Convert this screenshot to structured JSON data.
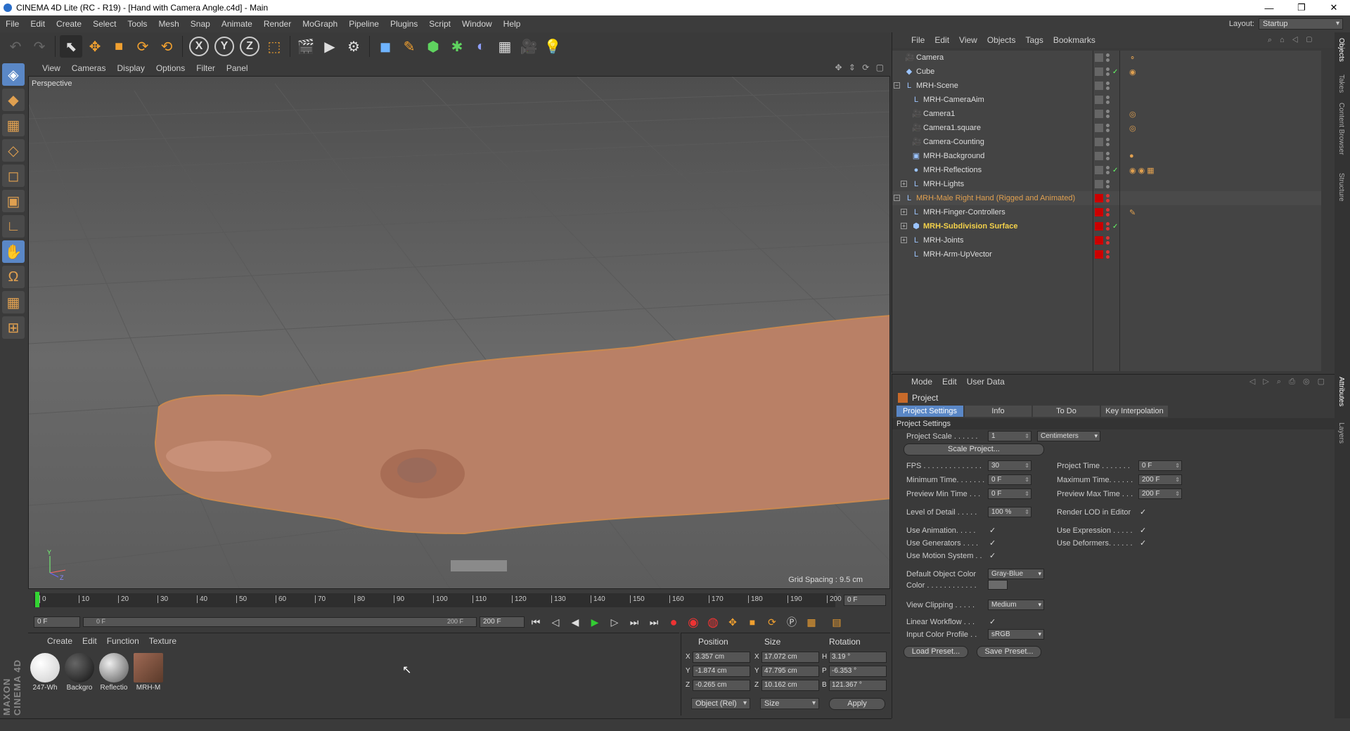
{
  "window": {
    "title": "CINEMA 4D Lite (RC - R19) - [Hand with Camera Angle.c4d] - Main",
    "minimize": "—",
    "maximize": "❐",
    "close": "✕"
  },
  "menubar": {
    "items": [
      "File",
      "Edit",
      "Create",
      "Select",
      "Tools",
      "Mesh",
      "Snap",
      "Animate",
      "Render",
      "MoGraph",
      "Pipeline",
      "Plugins",
      "Script",
      "Window",
      "Help"
    ],
    "layout_label": "Layout:",
    "layout_value": "Startup"
  },
  "toolbar": {
    "undo": "↶",
    "redo": "↷",
    "select": "⬉",
    "move": "✥",
    "scale": "■",
    "rotate": "⟳",
    "rotate2": "⟲",
    "x": "X",
    "y": "Y",
    "z": "Z",
    "coord": "⬚",
    "render_view": "🎬",
    "render_pv": "▶",
    "render_settings": "⚙",
    "cube": "◼",
    "pen": "✎",
    "subdiv": "⬢",
    "array": "✱",
    "deform": "◐",
    "floor": "▦",
    "camera": "🎥",
    "light": "💡"
  },
  "lefttools": [
    "◈",
    "◆",
    "▦",
    "◇",
    "◻",
    "▣",
    "∟",
    "✋",
    "Ω",
    "▦",
    "⊞"
  ],
  "brand": "MAXON CINEMA 4D",
  "viewport": {
    "menu": [
      "View",
      "Cameras",
      "Display",
      "Options",
      "Filter",
      "Panel"
    ],
    "nav_icons": "✥ ⇕ ⟳ ▢",
    "label": "Perspective",
    "grid_spacing": "Grid Spacing : 9.5 cm",
    "axis_y": "Y",
    "axis_z": "Z"
  },
  "timeline": {
    "ticks": [
      "0",
      "10",
      "20",
      "30",
      "40",
      "50",
      "60",
      "70",
      "80",
      "90",
      "100",
      "110",
      "120",
      "130",
      "140",
      "150",
      "160",
      "170",
      "180",
      "190",
      "200"
    ],
    "current_frame": "0 F"
  },
  "playbar": {
    "start": "0 F",
    "range_start": "0 F",
    "range_end": "200 F",
    "end": "200 F",
    "buttons": [
      "⏮",
      "◁",
      "◀",
      "▶",
      "▷",
      "⏭",
      "⏭"
    ]
  },
  "materials": {
    "menu": [
      "Create",
      "Edit",
      "Function",
      "Texture"
    ],
    "items": [
      {
        "name": "247-Wh",
        "color": "#f2f2f2"
      },
      {
        "name": "Backgro",
        "color": "#2b2b2b"
      },
      {
        "name": "Reflectio",
        "color": "#9a9a9a"
      },
      {
        "name": "MRH-M",
        "color": "#8a5a44"
      }
    ]
  },
  "coords": {
    "headers": [
      "Position",
      "Size",
      "Rotation"
    ],
    "rows": [
      {
        "axis": "X",
        "pos": "3.357 cm",
        "size_axis": "X",
        "size": "17.072 cm",
        "rot_axis": "H",
        "rot": "3.19 °"
      },
      {
        "axis": "Y",
        "pos": "-1.874 cm",
        "size_axis": "Y",
        "size": "47.795 cm",
        "rot_axis": "P",
        "rot": "-6.353 °"
      },
      {
        "axis": "Z",
        "pos": "-0.265 cm",
        "size_axis": "Z",
        "size": "10.162 cm",
        "rot_axis": "B",
        "rot": "121.367 °"
      }
    ],
    "mode": "Object (Rel)",
    "size_mode": "Size",
    "apply": "Apply"
  },
  "objects": {
    "menu": [
      "File",
      "Edit",
      "View",
      "Objects",
      "Tags",
      "Bookmarks"
    ],
    "rows": [
      {
        "name": "Camera",
        "indent": 0,
        "icon": "🎥",
        "expand": "",
        "highlight": false,
        "layer": "gray",
        "check": false,
        "tags": "⚬"
      },
      {
        "name": "Cube",
        "indent": 0,
        "icon": "◆",
        "expand": "",
        "highlight": false,
        "layer": "gray",
        "check": true,
        "tags": "◉"
      },
      {
        "name": "MRH-Scene",
        "indent": 0,
        "icon": "L",
        "expand": "−",
        "highlight": false,
        "layer": "gray",
        "check": false,
        "tags": ""
      },
      {
        "name": "MRH-CameraAim",
        "indent": 1,
        "icon": "L",
        "expand": "",
        "highlight": false,
        "layer": "gray",
        "check": false,
        "tags": ""
      },
      {
        "name": "Camera1",
        "indent": 1,
        "icon": "🎥",
        "expand": "",
        "highlight": false,
        "layer": "gray",
        "check": false,
        "tags": "◎"
      },
      {
        "name": "Camera1.square",
        "indent": 1,
        "icon": "🎥",
        "expand": "",
        "highlight": false,
        "layer": "gray",
        "check": false,
        "tags": "◎"
      },
      {
        "name": "Camera-Counting",
        "indent": 1,
        "icon": "🎥",
        "expand": "",
        "highlight": false,
        "layer": "gray",
        "check": false,
        "tags": ""
      },
      {
        "name": "MRH-Background",
        "indent": 1,
        "icon": "▣",
        "expand": "",
        "highlight": false,
        "layer": "gray",
        "check": false,
        "tags": "●"
      },
      {
        "name": "MRH-Reflections",
        "indent": 1,
        "icon": "●",
        "expand": "",
        "highlight": false,
        "layer": "gray",
        "check": true,
        "tags": "◉ ◉ ▦"
      },
      {
        "name": "MRH-Lights",
        "indent": 1,
        "icon": "L",
        "expand": "+",
        "highlight": false,
        "layer": "gray",
        "check": false,
        "tags": ""
      },
      {
        "name": "MRH-Male Right Hand (Rigged and Animated)",
        "indent": 0,
        "icon": "L",
        "expand": "−",
        "highlight": "orange",
        "layer": "red",
        "check": false,
        "tags": ""
      },
      {
        "name": "MRH-Finger-Controllers",
        "indent": 1,
        "icon": "L",
        "expand": "+",
        "highlight": false,
        "layer": "red",
        "check": false,
        "tags": "✎"
      },
      {
        "name": "MRH-Subdivision Surface",
        "indent": 1,
        "icon": "⬢",
        "expand": "+",
        "highlight": "yellow",
        "layer": "red",
        "check": true,
        "tags": ""
      },
      {
        "name": "MRH-Joints",
        "indent": 1,
        "icon": "L",
        "expand": "+",
        "highlight": false,
        "layer": "red",
        "check": false,
        "tags": ""
      },
      {
        "name": "MRH-Arm-UpVector",
        "indent": 1,
        "icon": "L",
        "expand": "",
        "highlight": false,
        "layer": "red",
        "check": false,
        "tags": ""
      }
    ]
  },
  "sidetabs": [
    "Objects",
    "Takes",
    "Content Browser",
    "Structure",
    "Attributes",
    "Layers"
  ],
  "attributes": {
    "menu": [
      "Mode",
      "Edit",
      "User Data"
    ],
    "title": "Project",
    "tabs": [
      "Project Settings",
      "Info",
      "To Do",
      "Key Interpolation"
    ],
    "section": "Project Settings",
    "project_scale_label": "Project Scale . . . . . .",
    "project_scale_value": "1",
    "project_scale_unit": "Centimeters",
    "scale_project_button": "Scale Project...",
    "left_fields": [
      {
        "label": "FPS . . . . . . . . . . . . . .",
        "value": "30"
      },
      {
        "label": "Minimum Time. . . . . . .",
        "value": "0 F"
      },
      {
        "label": "Preview Min Time . . .",
        "value": "0 F"
      }
    ],
    "right_fields": [
      {
        "label": "Project Time . . . . . . .",
        "value": "0 F"
      },
      {
        "label": "Maximum Time. . . . . .",
        "value": "200 F"
      },
      {
        "label": "Preview Max Time . . .",
        "value": "200 F"
      }
    ],
    "lod_label": "Level of Detail . . . . .",
    "lod_value": "100 %",
    "render_lod_label": "Render LOD in Editor",
    "checks_left": [
      "Use Animation. . . . .",
      "Use Generators . . . .",
      "Use Motion System . ."
    ],
    "checks_right": [
      "Use Expression . . . . .",
      "Use Deformers. . . . . ."
    ],
    "check_mark": "✓",
    "default_color_label": "Default Object Color",
    "default_color_value": "Gray-Blue",
    "color_label": "Color . . . . . . . . . . . .",
    "view_clipping_label": "View Clipping . . . . .",
    "view_clipping_value": "Medium",
    "linear_workflow_label": "Linear Workflow . . .",
    "input_profile_label": "Input Color Profile . .",
    "input_profile_value": "sRGB",
    "load_preset": "Load Preset...",
    "save_preset": "Save Preset..."
  }
}
